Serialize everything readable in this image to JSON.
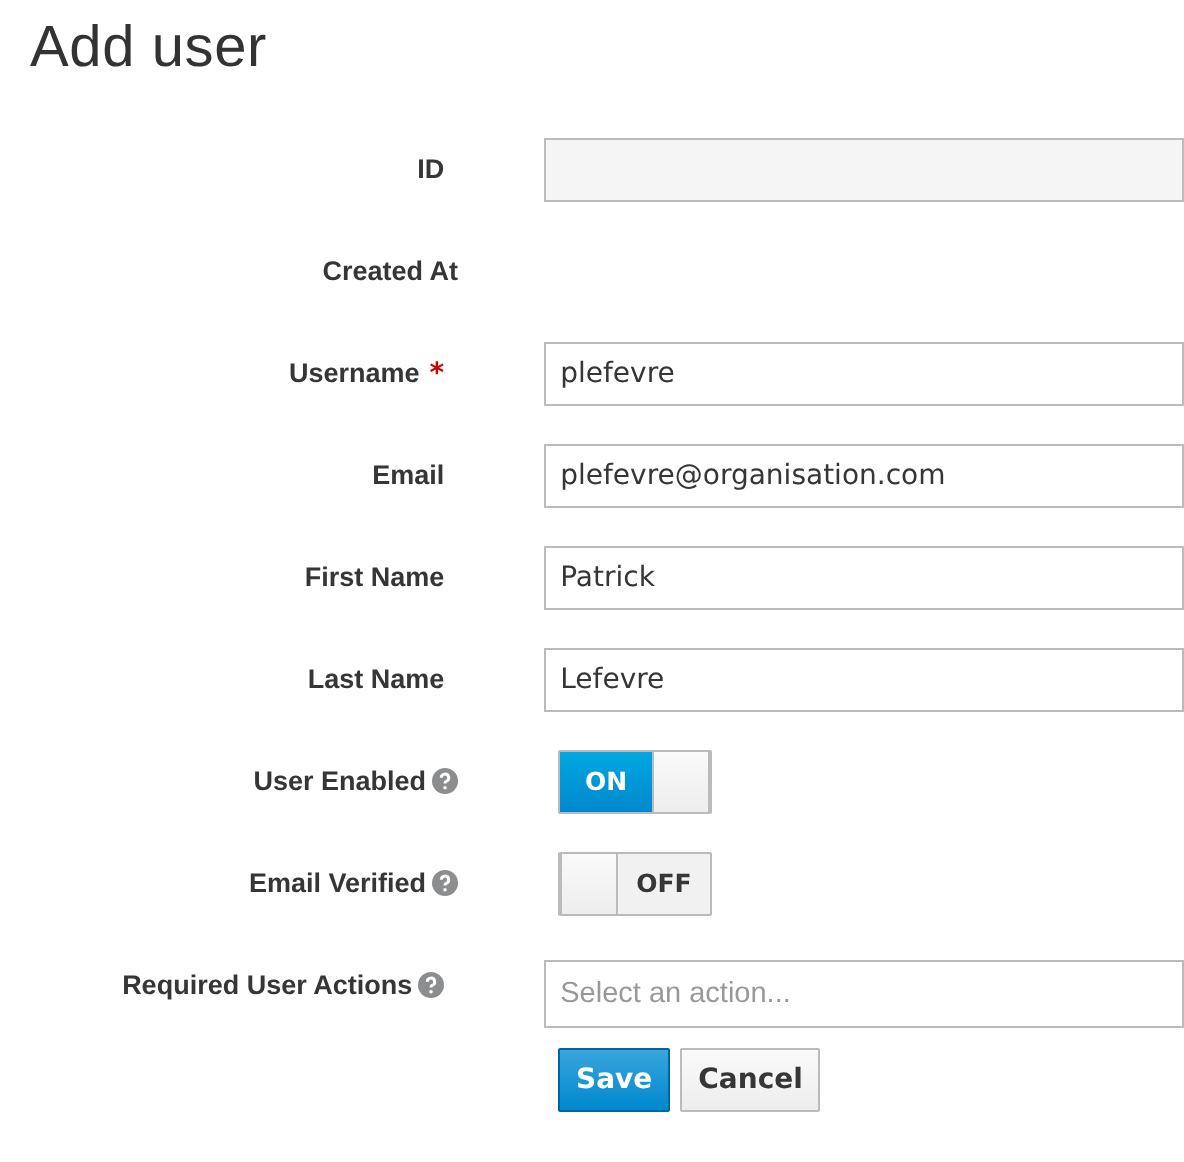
{
  "title": "Add user",
  "fields": [
    {
      "kind": "readonly",
      "label": "ID"
    },
    {
      "kind": "plain",
      "label": "Created At"
    },
    {
      "kind": "text",
      "label": "Username",
      "required": true,
      "value": "plefevre"
    },
    {
      "kind": "text",
      "label": "Email",
      "value": "plefevre@organisation.com"
    },
    {
      "kind": "text",
      "label": "First Name",
      "value": "Patrick"
    },
    {
      "kind": "text",
      "label": "Last Name",
      "value": "Lefevre"
    },
    {
      "kind": "toggle",
      "label": "User Enabled",
      "help": true,
      "on": true,
      "state_text": "ON"
    },
    {
      "kind": "toggle",
      "label": "Email Verified",
      "help": true,
      "on": false,
      "state_text": "OFF"
    },
    {
      "kind": "select",
      "label": "Required User Actions",
      "help": true,
      "placeholder": "Select an action..."
    }
  ],
  "required_mark": "*",
  "buttons": [
    {
      "label": "Save",
      "primary": true
    },
    {
      "label": "Cancel",
      "primary": false
    }
  ]
}
